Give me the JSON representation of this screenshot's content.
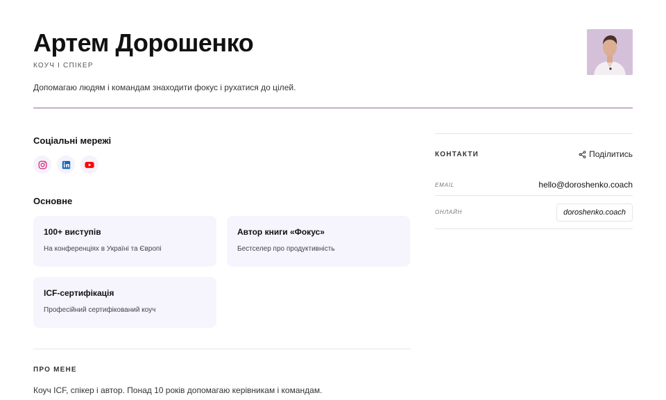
{
  "profile": {
    "name": "Артем Дорошенко",
    "role": "КОУЧ І СПІКЕР",
    "tagline": "Допомагаю людям і командам знаходити фокус і рухатися до цілей."
  },
  "social": {
    "title": "Соціальні мережі",
    "items": [
      {
        "icon": "instagram-icon",
        "color": "#d62976"
      },
      {
        "icon": "linkedin-icon",
        "color": "#0a66c2"
      },
      {
        "icon": "youtube-icon",
        "color": "#ff0000"
      }
    ]
  },
  "basics": {
    "title": "Основне",
    "cards": [
      {
        "title": "100+ виступів",
        "sub": "На конференціях в Україні та Європі"
      },
      {
        "title": "Автор книги «Фокус»",
        "sub": "Бестселер про продуктивність"
      },
      {
        "title": "ICF-сертифікація",
        "sub": "Професійний сертифікований коуч"
      }
    ]
  },
  "about": {
    "title": "ПРО МЕНЕ",
    "text": "Коуч ICF, спікер і автор. Понад 10 років допомагаю керівникам і командам."
  },
  "contacts": {
    "title": "КОНТАКТИ",
    "share_label": "Поділитись",
    "email_label": "EMAIL",
    "email_value": "hello@doroshenko.coach",
    "online_label": "ОНЛАЙН",
    "online_value": "doroshenko.coach"
  },
  "colors": {
    "accent_divider": "#8e6a97",
    "card_bg": "#f6f4fd"
  }
}
